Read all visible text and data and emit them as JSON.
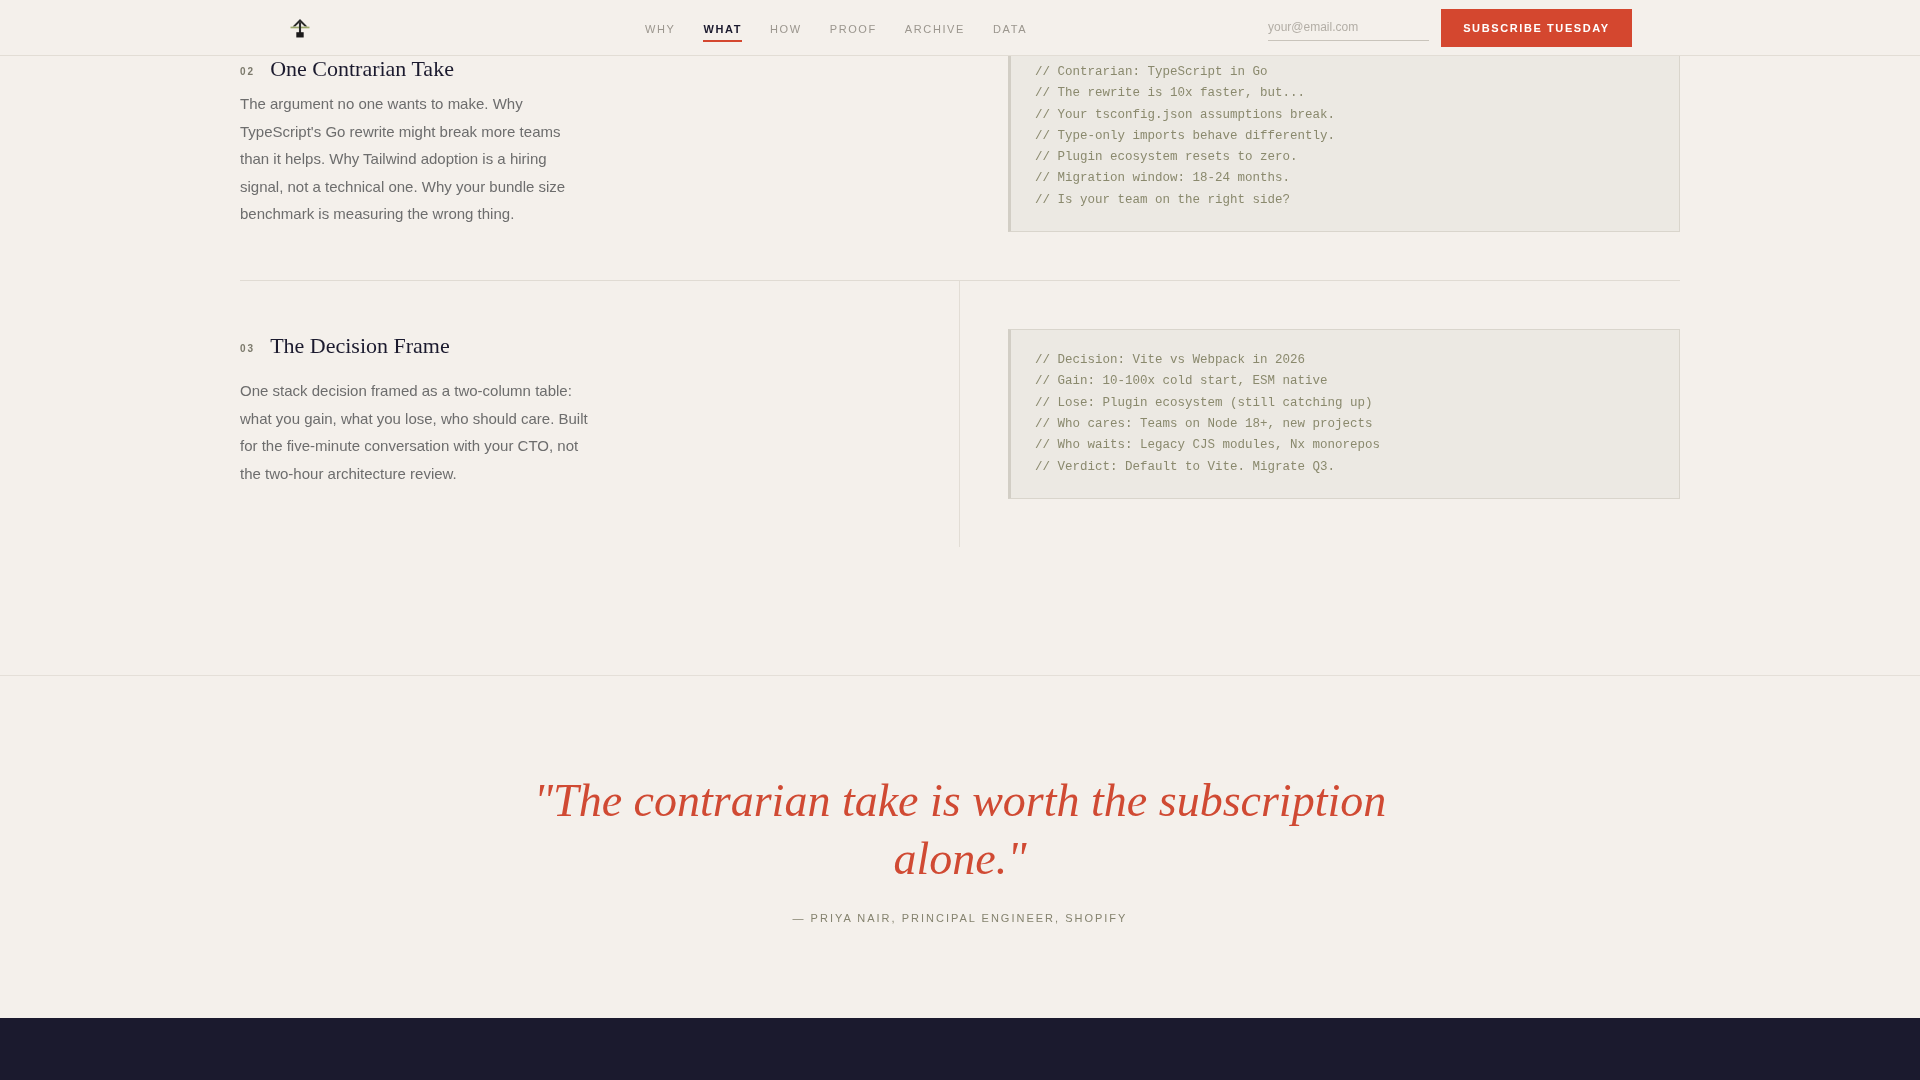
{
  "header": {
    "nav": [
      {
        "label": "WHY",
        "selected": false
      },
      {
        "label": "WHAT",
        "selected": true
      },
      {
        "label": "HOW",
        "selected": false
      },
      {
        "label": "PROOF",
        "selected": false
      },
      {
        "label": "ARCHIVE",
        "selected": false
      },
      {
        "label": "DATA",
        "selected": false
      }
    ],
    "email": {
      "placeholder": "your@email.com"
    },
    "subscribe_button": "SUBSCRIBE TUESDAY"
  },
  "sections": [
    {
      "number": "02",
      "title": "One Contrarian Take",
      "body": "The argument no one wants to make. Why TypeScript's Go rewrite might break more teams than it helps. Why Tailwind adoption is a hiring signal, not a technical one. Why your bundle size benchmark is measuring the wrong thing.",
      "code_lines": [
        "// Contrarian: TypeScript in Go",
        "// The rewrite is 10x faster, but...",
        "// Your tsconfig.json assumptions break.",
        "// Type-only imports behave differently.",
        "// Plugin ecosystem resets to zero.",
        "// Migration window: 18-24 months.",
        "// Is your team on the right side?"
      ]
    },
    {
      "number": "03",
      "title": "The Decision Frame",
      "body": "One stack decision framed as a two-column table: what you gain, what you lose, who should care. Built for the five-minute conversation with your CTO, not the two-hour architecture review.",
      "code_lines": [
        "// Decision: Vite vs Webpack in 2026",
        "// Gain: 10-100x cold start, ESM native",
        "// Lose: Plugin ecosystem (still catching up)",
        "// Who cares: Teams on Node 18+, new projects",
        "// Who waits: Legacy CJS modules, Nx monorepos",
        "// Verdict: Default to Vite. Migrate Q3."
      ]
    }
  ],
  "testimonial": {
    "quote": "\"The contrarian take is worth the subscription alone.\"",
    "attribution": "— PRIYA NAIR, PRINCIPAL ENGINEER, SHOPIFY"
  }
}
